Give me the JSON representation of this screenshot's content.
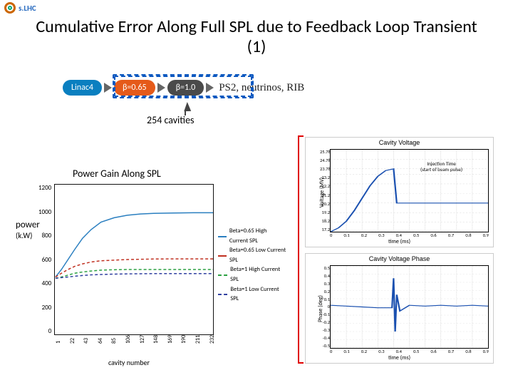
{
  "logo_text": "s.LHC",
  "title": "Cumulative Error Along Full SPL due to Feedback Loop Transient (1)",
  "chain": {
    "linac4": "Linac4",
    "b065": "β=0.65",
    "b10": "β=1.0",
    "ps2": "PS2, neutrinos, RIB"
  },
  "cavities_label": "254 cavities",
  "injection_label": "Injection Time\n(start of beam pulse)",
  "chart_data": [
    {
      "type": "line",
      "title": "Power Gain Along SPL",
      "xlabel": "cavity number",
      "ylabel": "power",
      "yunit": "(k.W)",
      "xticks": [
        1,
        22,
        43,
        64,
        85,
        106,
        127,
        148,
        169,
        190,
        211,
        232
      ],
      "ylim": [
        0,
        1200
      ],
      "yticks": [
        0,
        200,
        400,
        600,
        800,
        1000,
        1200
      ],
      "series": [
        {
          "name": "Beta=0.65 High Current SPL",
          "color": "#2a7fc0",
          "dash": false,
          "x": [
            1,
            10,
            20,
            30,
            42,
            55,
            70,
            90,
            110,
            130,
            150,
            180,
            210,
            240
          ],
          "y": [
            460,
            520,
            600,
            680,
            770,
            840,
            900,
            935,
            955,
            965,
            970,
            973,
            975,
            975
          ]
        },
        {
          "name": "Beta=0.65 Low Current SPL",
          "color": "#c03020",
          "dash": true,
          "x": [
            1,
            10,
            20,
            30,
            42,
            55,
            70,
            90,
            110,
            130,
            150,
            180,
            210,
            240
          ],
          "y": [
            460,
            490,
            520,
            545,
            565,
            580,
            590,
            595,
            600,
            602,
            604,
            605,
            605,
            605
          ]
        },
        {
          "name": "Beta=1 High Current SPL",
          "color": "#2aa040",
          "dash": true,
          "x": [
            1,
            10,
            20,
            30,
            42,
            55,
            70,
            90,
            110,
            130,
            150,
            180,
            210,
            240
          ],
          "y": [
            450,
            460,
            475,
            490,
            500,
            508,
            515,
            518,
            520,
            520,
            520,
            520,
            520,
            520
          ]
        },
        {
          "name": "Beta=1 Low Current SPL",
          "color": "#3040a0",
          "dash": true,
          "x": [
            1,
            10,
            20,
            30,
            42,
            55,
            70,
            90,
            110,
            130,
            150,
            180,
            210,
            240
          ],
          "y": [
            450,
            455,
            460,
            466,
            472,
            477,
            480,
            483,
            485,
            486,
            487,
            487,
            487,
            487
          ]
        }
      ]
    },
    {
      "type": "line",
      "title": "Cavity Voltage",
      "xlabel": "time (ms)",
      "ylabel": "Voltage (MV)",
      "xlim": [
        0,
        1
      ],
      "xticks": [
        0,
        0.1,
        0.2,
        0.3,
        0.4,
        0.5,
        0.6,
        0.7,
        0.8,
        0.9
      ],
      "yticks": [
        17.2,
        18.2,
        19.2,
        20.2,
        21.2,
        22.2,
        23.2,
        23.78,
        24.78,
        25.78
      ],
      "ylim": [
        17.2,
        25.78
      ],
      "series": [
        {
          "color": "#1a50b0",
          "x": [
            0,
            0.05,
            0.1,
            0.15,
            0.2,
            0.25,
            0.3,
            0.35,
            0.4,
            0.42,
            0.44,
            0.5,
            0.6,
            0.7,
            0.8,
            0.9,
            1.0
          ],
          "y": [
            17.2,
            17.6,
            18.3,
            19.4,
            20.7,
            22.0,
            23.0,
            23.6,
            23.78,
            20.2,
            20.2,
            20.2,
            20.2,
            20.2,
            20.2,
            20.2,
            20.2
          ]
        }
      ]
    },
    {
      "type": "line",
      "title": "Cavity Voltage Phase",
      "xlabel": "time (ms)",
      "ylabel": "Phase (deg)",
      "xlim": [
        0,
        1
      ],
      "xticks": [
        0,
        0.1,
        0.2,
        0.3,
        0.4,
        0.5,
        0.6,
        0.7,
        0.8,
        0.9
      ],
      "yticks": [
        -0.5,
        -0.4,
        -0.3,
        -0.2,
        -0.1,
        0,
        0.1,
        0.2,
        0.3,
        0.4,
        0.5
      ],
      "ylim": [
        -0.5,
        0.5
      ],
      "series": [
        {
          "color": "#1a50b0",
          "x": [
            0,
            0.1,
            0.2,
            0.3,
            0.39,
            0.4,
            0.41,
            0.42,
            0.44,
            0.5,
            0.6,
            0.7,
            0.8,
            0.9,
            1.0
          ],
          "y": [
            0.02,
            0.01,
            0,
            -0.01,
            -0.01,
            0.35,
            -0.3,
            0.15,
            -0.05,
            0.02,
            0.01,
            0.02,
            0.01,
            0.02,
            0.01
          ]
        }
      ]
    }
  ]
}
